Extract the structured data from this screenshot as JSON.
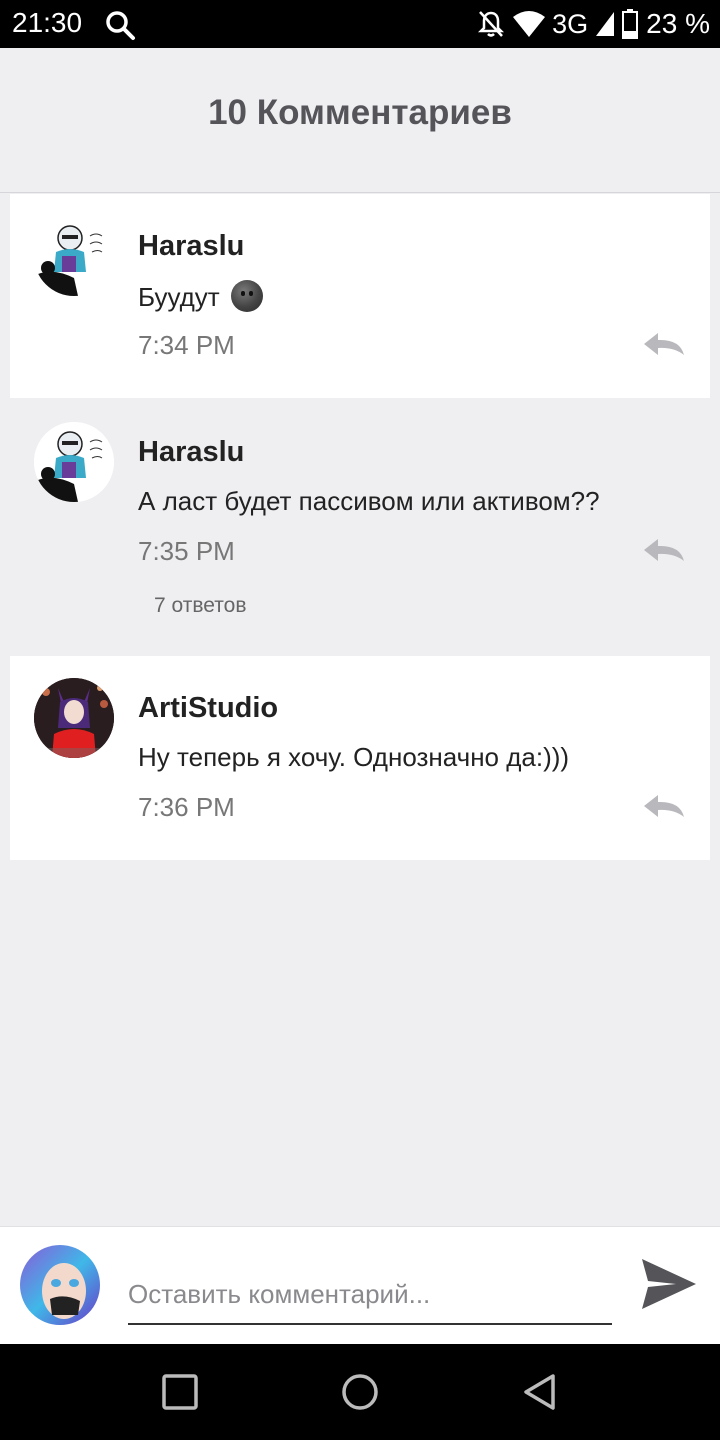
{
  "status_bar": {
    "time": "21:30",
    "network": "3G",
    "battery": "23 %",
    "icons": [
      "search-icon",
      "notifications-off-icon",
      "wifi-icon",
      "signal-icon",
      "battery-icon"
    ]
  },
  "header": {
    "title": "10 Комментариев"
  },
  "comments": [
    {
      "author": "Haraslu",
      "text": "Буудут",
      "emoji": "dark-smiley-emoji",
      "time": "7:34 PM",
      "replies": ""
    },
    {
      "author": "Haraslu",
      "text": "А ласт будет пассивом или активом??",
      "time": "7:35 PM",
      "replies": "7 ответов"
    },
    {
      "author": "ArtiStudio",
      "text": "Ну теперь я хочу. Однозначно да:)))",
      "time": "7:36 PM",
      "replies": ""
    }
  ],
  "composer": {
    "placeholder": "Оставить комментарий...",
    "value": ""
  },
  "colors": {
    "background": "#efeef1",
    "card": "#ffffff",
    "text": "#222222",
    "muted": "#777777"
  }
}
